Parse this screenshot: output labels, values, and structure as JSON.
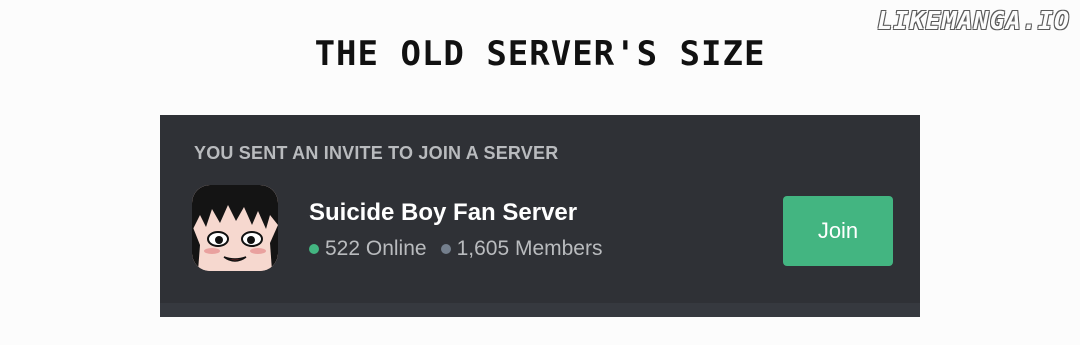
{
  "watermark": "LIKEMANGA.IO",
  "caption": "THE OLD SERVER'S SIZE",
  "invite": {
    "header": "YOU SENT AN INVITE TO JOIN A SERVER",
    "server_name": "Suicide Boy Fan Server",
    "online_text": "522 Online",
    "members_text": "1,605 Members",
    "join_label": "Join",
    "icon": "anime-boy-avatar-icon",
    "colors": {
      "card_bg": "#2f3136",
      "online_dot": "#43b581",
      "members_dot": "#747f8d",
      "join_button": "#43b581"
    }
  }
}
